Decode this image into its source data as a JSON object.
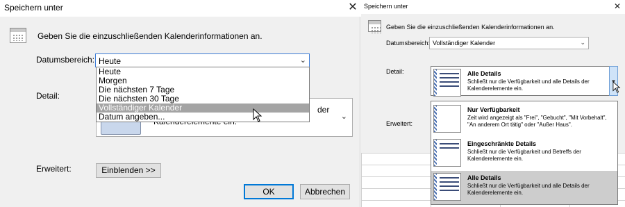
{
  "left_dialog": {
    "title": "Speichern unter",
    "close_label": "✕",
    "instruction": "Geben Sie die einzuschließenden Kalenderinformationen an.",
    "date_range_label": "Datumsbereich:",
    "date_range_value": "Heute",
    "date_range_options": [
      "Heute",
      "Morgen",
      "Die nächsten 7 Tage",
      "Die nächsten 30 Tage",
      "Vollständiger Kalender",
      "Datum angeben..."
    ],
    "detail_label": "Detail:",
    "detail_peek_1": "der",
    "detail_peek_2": "Kalenderelemente ein.",
    "advanced_label": "Erweitert:",
    "show_button": "Einblenden >>",
    "ok_button": "OK",
    "cancel_button": "Abbrechen"
  },
  "right_dialog": {
    "title": "Speichern unter",
    "close_label": "✕",
    "instruction": "Geben Sie die einzuschließenden Kalenderinformationen an.",
    "date_range_label": "Datumsbereich:",
    "date_range_value": "Vollständiger Kalender",
    "detail_label": "Detail:",
    "advanced_label": "Erweitert:",
    "current_detail": {
      "name": "Alle Details",
      "desc": "Schließt nur die Verfügbarkeit und alle Details der Kalenderelemente ein."
    },
    "detail_options": [
      {
        "name": "Nur Verfügbarkeit",
        "desc": "Zeit wird angezeigt als \"Frei\", \"Gebucht\", \"Mit Vorbehalt\", \"An anderem Ort tätig\" oder \"Außer Haus\"."
      },
      {
        "name": "Eingeschränkte Details",
        "desc": "Schließt nur die Verfügbarkeit und Betreffs der Kalenderelemente ein."
      },
      {
        "name": "Alle Details",
        "desc": "Schließt nur die Verfügbarkeit und alle Details der Kalenderelemente ein."
      }
    ],
    "selected_option": "Alle Details"
  },
  "colors": {
    "focus_border": "#3b7bd6",
    "selection_gray": "#a4a4a4",
    "default_button_border": "#0078d7",
    "dialog_bg": "#f0f0f0"
  }
}
